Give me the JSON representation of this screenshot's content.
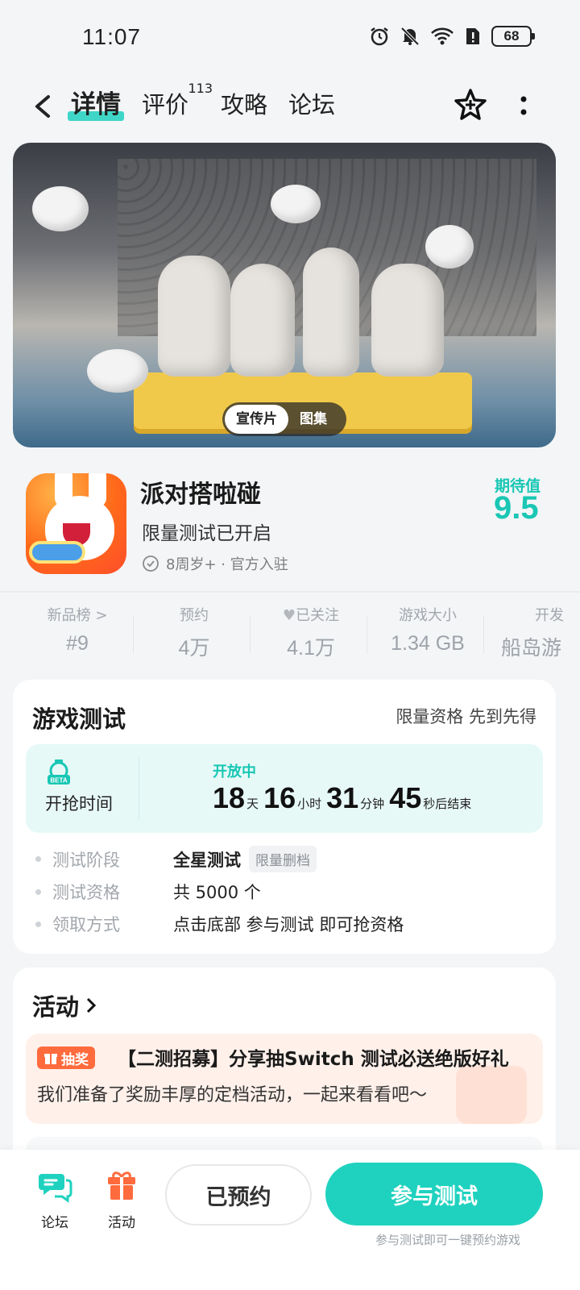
{
  "status_bar": {
    "time": "11:07",
    "battery": "68"
  },
  "nav": {
    "tabs": [
      {
        "label": "详情",
        "active": true
      },
      {
        "label": "评价",
        "count": "113"
      },
      {
        "label": "攻略"
      },
      {
        "label": "论坛"
      }
    ],
    "icons": [
      "back-icon",
      "star-icon",
      "more-icon"
    ]
  },
  "hero": {
    "tabs": [
      "宣传片",
      "图集"
    ],
    "active_tab": "宣传片"
  },
  "app": {
    "name": "派对搭啦碰",
    "subtitle": "限量测试已开启",
    "meta": "8周岁+ · 官方入驻",
    "expect_label": "期待值",
    "expect_value": "9.5"
  },
  "stats": [
    {
      "label": "新品榜 >",
      "value": "#9"
    },
    {
      "label": "预约",
      "value": "4万"
    },
    {
      "label": "已关注",
      "value": "4.1万"
    },
    {
      "label": "游戏大小",
      "value": "1.34 GB"
    },
    {
      "label": "开发",
      "value": "船岛游"
    }
  ],
  "test": {
    "title": "游戏测试",
    "right_text": "限量资格 先到先得",
    "countdown_label": "开抢时间",
    "status": "开放中",
    "days": "18",
    "days_unit": "天",
    "hours": "16",
    "hours_unit": "小时",
    "minutes": "31",
    "minutes_unit": "分钟",
    "seconds": "45",
    "seconds_unit": "秒后结束",
    "rows": [
      {
        "key": "测试阶段",
        "value": "全星测试",
        "badge": "限量删档"
      },
      {
        "key": "测试资格",
        "value": "共 5000 个"
      },
      {
        "key": "领取方式",
        "value": "点击底部 参与测试 即可抢资格"
      }
    ]
  },
  "activity": {
    "title": "活动",
    "items": [
      {
        "tag": "抽奖",
        "title": "【二测招募】分享抽Switch 测试必送绝版好礼",
        "desc": "我们准备了奖励丰厚的定档活动，一起来看看吧～"
      }
    ]
  },
  "bottom": {
    "forum_label": "论坛",
    "activity_label": "活动",
    "reserved_label": "已预约",
    "join_label": "参与测试",
    "join_hint": "参与测试即可一键预约游戏"
  },
  "colors": {
    "accent": "#1fd2bf",
    "tag": "#ff6b3d"
  }
}
